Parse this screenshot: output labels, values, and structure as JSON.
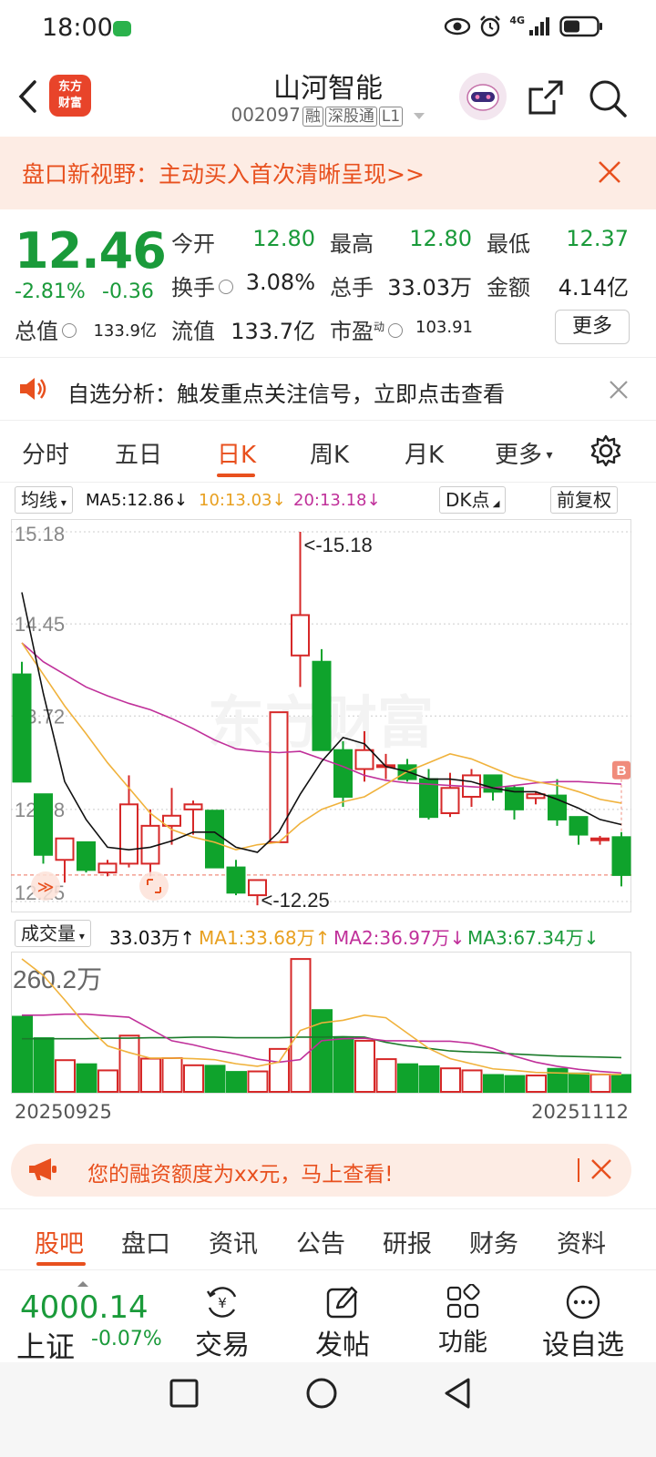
{
  "status_bar": {
    "time": "18:00",
    "network": "4G"
  },
  "header": {
    "logo_text_line1": "东方",
    "logo_text_line2": "财富",
    "stock_name": "山河智能",
    "stock_code": "002097",
    "tags": [
      "融",
      "深股通",
      "L1"
    ]
  },
  "promo_banner": {
    "text": "盘口新视野：主动买入首次清晰呈现>>"
  },
  "quote": {
    "price": "12.46",
    "change_pct": "-2.81%",
    "change_abs": "-0.36",
    "open_label": "今开",
    "open": "12.80",
    "high_label": "最高",
    "high": "12.80",
    "low_label": "最低",
    "low": "12.37",
    "turnover_label": "换手",
    "turnover": "3.08%",
    "volume_label": "总手",
    "volume": "33.03万",
    "amount_label": "金额",
    "amount": "4.14亿",
    "mcap_label": "总值",
    "mcap": "133.9亿",
    "float_label": "流值",
    "float": "133.7亿",
    "pe_label": "市盈",
    "pe_sup": "动",
    "pe": "103.91",
    "more_label": "更多"
  },
  "alert": {
    "text": "自选分析：触发重点关注信号，立即点击查看"
  },
  "period_tabs": [
    "分时",
    "五日",
    "日K",
    "周K",
    "月K",
    "更多"
  ],
  "active_period": "日K",
  "ma_row": {
    "indicator": "均线",
    "ma5": "MA5:12.86↓",
    "ma10": "10:13.03↓",
    "ma20": "20:13.18↓",
    "dk": "DK点",
    "adjust": "前复权"
  },
  "chart_labels": {
    "y_ticks": [
      "15.18",
      "14.45",
      "13.72",
      "12.98",
      "12.25"
    ],
    "high_marker": "<-15.18",
    "low_marker": "<-12.25",
    "b_marker": "B",
    "watermark": "东方财富"
  },
  "volume_row": {
    "indicator": "成交量",
    "vol": "33.03万↑",
    "ma1": "MA1:33.68万↑",
    "ma2": "MA2:36.97万↓",
    "ma3": "MA3:67.34万↓",
    "max_label": "260.2万"
  },
  "dates": {
    "start": "20250925",
    "end": "20251112"
  },
  "margin_banner": {
    "text": "您的融资额度为xx元，马上查看!"
  },
  "info_tabs": [
    "股吧",
    "盘口",
    "资讯",
    "公告",
    "研报",
    "财务",
    "资料"
  ],
  "active_info_tab": "股吧",
  "bottom_bar": {
    "index_value": "4000.14",
    "index_name": "上证",
    "index_change": "-0.07%",
    "items": [
      "交易",
      "发帖",
      "功能",
      "设自选"
    ]
  },
  "colors": {
    "up": "#d62828",
    "down": "#0fa32c",
    "accent": "#e8501e",
    "ma5": "#111111",
    "ma10": "#f0b23c",
    "ma20": "#c0309a"
  },
  "chart_data": {
    "type": "candlestick",
    "x_range": [
      "20250925",
      "20251112"
    ],
    "ylim": [
      12.25,
      15.18
    ],
    "candles": [
      {
        "o": 14.05,
        "h": 14.15,
        "l": 13.2,
        "c": 13.2
      },
      {
        "o": 13.1,
        "h": 13.1,
        "l": 12.55,
        "c": 12.62
      },
      {
        "o": 12.58,
        "h": 12.75,
        "l": 12.4,
        "c": 12.75
      },
      {
        "o": 12.72,
        "h": 12.72,
        "l": 12.48,
        "c": 12.5
      },
      {
        "o": 12.48,
        "h": 12.58,
        "l": 12.45,
        "c": 12.55
      },
      {
        "o": 12.55,
        "h": 13.25,
        "l": 12.52,
        "c": 13.02
      },
      {
        "o": 12.55,
        "h": 12.98,
        "l": 12.45,
        "c": 12.85
      },
      {
        "o": 12.85,
        "h": 13.15,
        "l": 12.7,
        "c": 12.93
      },
      {
        "o": 12.98,
        "h": 13.05,
        "l": 12.78,
        "c": 13.02
      },
      {
        "o": 12.97,
        "h": 12.97,
        "l": 12.52,
        "c": 12.52
      },
      {
        "o": 12.52,
        "h": 12.58,
        "l": 12.3,
        "c": 12.32
      },
      {
        "o": 12.3,
        "h": 12.42,
        "l": 12.22,
        "c": 12.42
      },
      {
        "o": 12.72,
        "h": 13.75,
        "l": 12.72,
        "c": 13.75
      },
      {
        "o": 14.2,
        "h": 15.18,
        "l": 13.95,
        "c": 14.52
      },
      {
        "o": 14.15,
        "h": 14.25,
        "l": 13.45,
        "c": 13.45
      },
      {
        "o": 13.45,
        "h": 13.52,
        "l": 13.0,
        "c": 13.08
      },
      {
        "o": 13.3,
        "h": 13.6,
        "l": 13.2,
        "c": 13.45
      },
      {
        "o": 13.32,
        "h": 13.42,
        "l": 13.22,
        "c": 13.33
      },
      {
        "o": 13.33,
        "h": 13.38,
        "l": 13.2,
        "c": 13.22
      },
      {
        "o": 13.22,
        "h": 13.3,
        "l": 12.9,
        "c": 12.92
      },
      {
        "o": 12.95,
        "h": 13.27,
        "l": 12.92,
        "c": 13.15
      },
      {
        "o": 13.08,
        "h": 13.3,
        "l": 13.0,
        "c": 13.25
      },
      {
        "o": 13.25,
        "h": 13.25,
        "l": 13.05,
        "c": 13.12
      },
      {
        "o": 13.15,
        "h": 13.17,
        "l": 12.9,
        "c": 12.98
      },
      {
        "o": 13.07,
        "h": 13.12,
        "l": 13.02,
        "c": 13.1
      },
      {
        "o": 13.09,
        "h": 13.22,
        "l": 12.85,
        "c": 12.9
      },
      {
        "o": 12.92,
        "h": 12.92,
        "l": 12.7,
        "c": 12.78
      },
      {
        "o": 12.75,
        "h": 12.77,
        "l": 12.7,
        "c": 12.75
      },
      {
        "o": 12.76,
        "h": 12.8,
        "l": 12.37,
        "c": 12.46
      }
    ],
    "ma5": [
      14.7,
      13.9,
      13.2,
      12.9,
      12.68,
      12.66,
      12.68,
      12.73,
      12.8,
      12.8,
      12.68,
      12.64,
      12.8,
      13.1,
      13.36,
      13.55,
      13.5,
      13.32,
      13.28,
      13.22,
      13.22,
      13.2,
      13.15,
      13.12,
      13.12,
      13.06,
      12.99,
      12.9,
      12.86
    ],
    "ma10": [
      14.3,
      14.05,
      13.8,
      13.58,
      13.35,
      13.15,
      12.95,
      12.82,
      12.76,
      12.72,
      12.66,
      12.7,
      12.72,
      12.87,
      12.98,
      13.04,
      13.08,
      13.18,
      13.28,
      13.35,
      13.42,
      13.38,
      13.31,
      13.24,
      13.2,
      13.17,
      13.12,
      13.06,
      13.03
    ],
    "ma20": [
      14.3,
      14.15,
      14.05,
      13.95,
      13.88,
      13.82,
      13.77,
      13.7,
      13.62,
      13.53,
      13.46,
      13.44,
      13.43,
      13.44,
      13.38,
      13.32,
      13.25,
      13.21,
      13.19,
      13.18,
      13.17,
      13.16,
      13.15,
      13.17,
      13.19,
      13.2,
      13.2,
      13.19,
      13.18
    ]
  },
  "volume_data": {
    "max": 260.2,
    "unit": "万",
    "values": [
      147,
      105,
      62,
      54,
      42,
      110,
      65,
      66,
      52,
      51,
      39,
      40,
      84,
      260,
      160,
      105,
      100,
      64,
      54,
      50,
      46,
      42,
      33,
      31,
      32,
      45,
      36,
      34,
      33
    ],
    "ma1": [
      270,
      228,
      180,
      130,
      90,
      77,
      66,
      66,
      65,
      63,
      55,
      50,
      58,
      120,
      135,
      140,
      150,
      145,
      115,
      85,
      65,
      55,
      45,
      42,
      38,
      37,
      36,
      34,
      34
    ],
    "ma2": [
      150,
      150,
      152,
      152,
      149,
      146,
      123,
      100,
      92,
      82,
      74,
      64,
      58,
      63,
      100,
      104,
      105,
      100,
      100,
      99,
      99,
      95,
      85,
      70,
      58,
      50,
      44,
      40,
      37
    ],
    "ma3": [
      104,
      104,
      104,
      104,
      105,
      105,
      106,
      106,
      107,
      107,
      106,
      106,
      106,
      107,
      107,
      108,
      107,
      97,
      90,
      85,
      80,
      78,
      77,
      74,
      72,
      70,
      69,
      68,
      67
    ]
  }
}
